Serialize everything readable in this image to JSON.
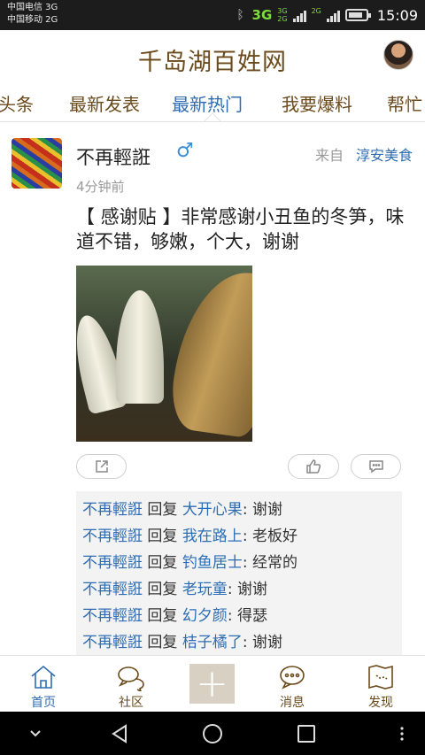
{
  "status_bar": {
    "carrier1": "中国电信 3G",
    "carrier2": "中国移动 2G",
    "network": "3G",
    "network_small_top": "3G",
    "network_small_bottom": "2G",
    "network_small_right": "2G",
    "time": "15:09",
    "battery_level": 0.85
  },
  "header": {
    "title": "千岛湖百姓网"
  },
  "tabs": [
    {
      "label": "头条"
    },
    {
      "label": "最新发表"
    },
    {
      "label": "最新热门"
    },
    {
      "label": "我要爆料"
    },
    {
      "label": "帮忙"
    }
  ],
  "active_tab": "最新热门",
  "post": {
    "author": "不再輕誑",
    "gender_symbol": "♂",
    "source_prefix": "来自",
    "source": "淳安美食",
    "time": "4分钟前",
    "text": "【 感谢贴 】非常感谢小丑鱼的冬笋，味道不错，够嫩，个大，谢谢"
  },
  "replies": [
    {
      "user": "不再輕誑",
      "verb": "回复",
      "target": "大开心果",
      "text": ": 谢谢"
    },
    {
      "user": "不再輕誑",
      "verb": "回复",
      "target": "我在路上",
      "text": ": 老板好"
    },
    {
      "user": "不再輕誑",
      "verb": "回复",
      "target": "钓鱼居士",
      "text": ": 经常的"
    },
    {
      "user": "不再輕誑",
      "verb": "回复",
      "target": "老玩童",
      "text": ": 谢谢"
    },
    {
      "user": "不再輕誑",
      "verb": "回复",
      "target": "幻夕颜",
      "text": ": 得瑟"
    },
    {
      "user": "不再輕誑",
      "verb": "回复",
      "target": "桔子橘了",
      "text": ": 谢谢"
    }
  ],
  "bottom_nav": [
    {
      "label": "首页",
      "icon": "home-icon"
    },
    {
      "label": "社区",
      "icon": "community-icon"
    },
    {
      "label": "消息",
      "icon": "message-icon"
    },
    {
      "label": "发现",
      "icon": "discover-icon"
    }
  ],
  "colors": {
    "brand_brown": "#6b4a1c",
    "link_blue": "#2d6db4"
  }
}
